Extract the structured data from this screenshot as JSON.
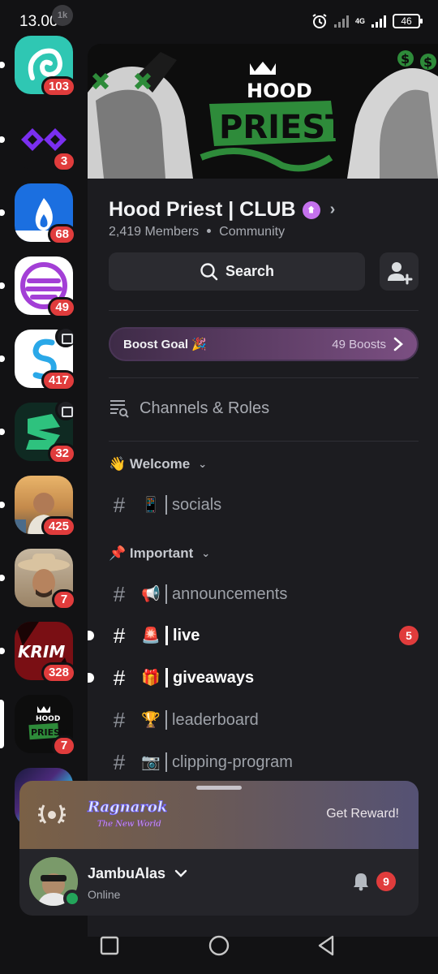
{
  "status_bar": {
    "time": "13.00",
    "ghost_badge": "1k",
    "network": "4G",
    "battery": "46"
  },
  "rail": {
    "servers": [
      {
        "name": "server-1",
        "badge": "103",
        "color": "#2fc7b3"
      },
      {
        "name": "server-2",
        "badge": "3",
        "color": "#121214"
      },
      {
        "name": "server-3",
        "badge": "68",
        "color": "#1b6fe0"
      },
      {
        "name": "server-4",
        "badge": "49",
        "color": "#ffffff"
      },
      {
        "name": "server-5",
        "badge": "417",
        "color": "#ffffff"
      },
      {
        "name": "server-6",
        "badge": "32",
        "color": "#0f2a22"
      },
      {
        "name": "server-7",
        "badge": "425",
        "color": "#c49a5b"
      },
      {
        "name": "server-8",
        "badge": "7",
        "color": "#8b6e4f"
      },
      {
        "name": "server-9",
        "badge": "328",
        "color": "#7a0f14"
      },
      {
        "name": "server-hood-priest",
        "badge": "7",
        "color": "#0d0d0d"
      }
    ]
  },
  "server": {
    "name": "Hood Priest | CLUB",
    "members": "2,419 Members",
    "type": "Community",
    "banner_top": "HOOD",
    "banner_bottom": "PRIEST"
  },
  "search": {
    "label": "Search"
  },
  "boost": {
    "goal": "Boost Goal 🎉",
    "count": "49 Boosts"
  },
  "channels_roles": "Channels & Roles",
  "categories": [
    {
      "label": "👋 Welcome"
    },
    {
      "label": "📌 Important"
    }
  ],
  "channels": [
    {
      "emoji": "📱",
      "name": "socials",
      "unread": false
    },
    {
      "emoji": "📢",
      "name": "announcements",
      "unread": false
    },
    {
      "emoji": "🚨",
      "name": "live",
      "unread": true,
      "mentions": "5"
    },
    {
      "emoji": "🎁",
      "name": "giveaways",
      "unread": true
    },
    {
      "emoji": "🏆",
      "name": "leaderboard",
      "unread": false
    },
    {
      "emoji": "📷",
      "name": "clipping-program",
      "unread": false
    }
  ],
  "reward": {
    "logo_text": "Ragnarok",
    "logo_sub": "The New World",
    "cta": "Get Reward!"
  },
  "user": {
    "name": "JambuAlas",
    "status": "Online",
    "notifications": "9"
  },
  "colors": {
    "accent_red": "#e03c3c",
    "online": "#23a55a",
    "boost_purple": "#7b4f82",
    "banner_green": "#2e8b3a"
  }
}
